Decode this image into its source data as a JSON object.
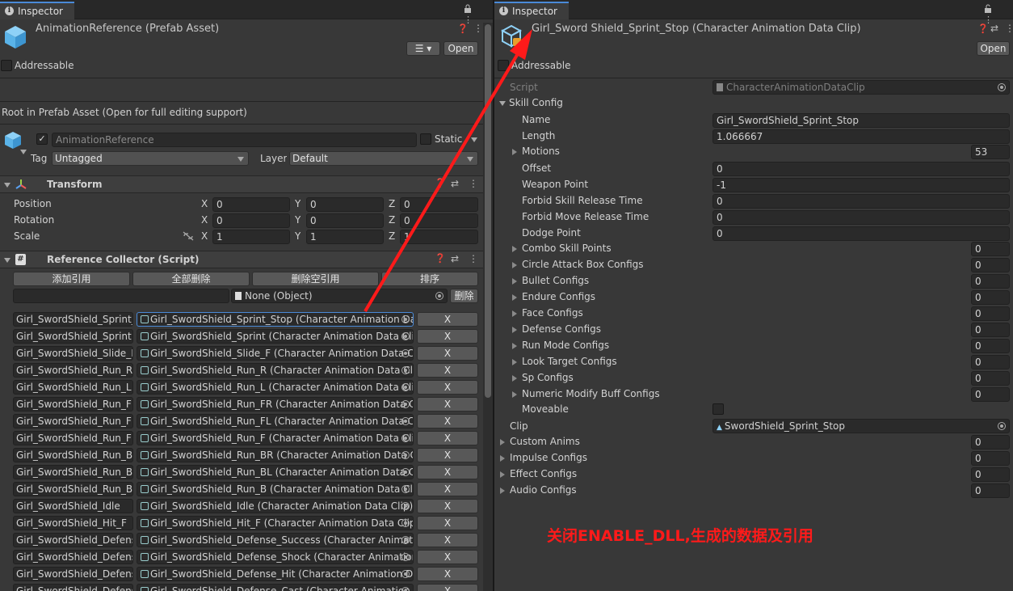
{
  "left": {
    "tab_label": "Inspector",
    "asset_title": "AnimationReference (Prefab Asset)",
    "open_button": "Open",
    "addressable_label": "Addressable",
    "root_info": "Root in Prefab Asset (Open for full editing support)",
    "gameobject_name": "AnimationReference",
    "static_label": "Static",
    "tag_label": "Tag",
    "tag_value": "Untagged",
    "layer_label": "Layer",
    "layer_value": "Default",
    "transform": {
      "title": "Transform",
      "rows": [
        {
          "label": "Position",
          "x": "0",
          "y": "0",
          "z": "0"
        },
        {
          "label": "Rotation",
          "x": "0",
          "y": "0",
          "z": "0"
        },
        {
          "label": "Scale",
          "x": "1",
          "y": "1",
          "z": "1"
        }
      ],
      "axis_x": "X",
      "axis_y": "Y",
      "axis_z": "Z"
    },
    "collector": {
      "title": "Reference Collector (Script)",
      "buttons": [
        "添加引用",
        "全部删除",
        "删除空引用",
        "排序"
      ],
      "none_object": "None (Object)",
      "delete_button": "删除",
      "x_label": "X",
      "items": [
        {
          "key": "Girl_SwordShield_Sprint_S",
          "obj": "Girl_SwordShield_Sprint_Stop (Character Animation Dat"
        },
        {
          "key": "Girl_SwordShield_Sprint",
          "obj": "Girl_SwordShield_Sprint (Character Animation Data Clip"
        },
        {
          "key": "Girl_SwordShield_Slide_F",
          "obj": "Girl_SwordShield_Slide_F (Character Animation Data Cl"
        },
        {
          "key": "Girl_SwordShield_Run_R",
          "obj": "Girl_SwordShield_Run_R (Character Animation Data Clip"
        },
        {
          "key": "Girl_SwordShield_Run_L",
          "obj": "Girl_SwordShield_Run_L (Character Animation Data Clip"
        },
        {
          "key": "Girl_SwordShield_Run_FR",
          "obj": "Girl_SwordShield_Run_FR (Character Animation Data Cl"
        },
        {
          "key": "Girl_SwordShield_Run_FL",
          "obj": "Girl_SwordShield_Run_FL (Character Animation Data Cl"
        },
        {
          "key": "Girl_SwordShield_Run_F",
          "obj": "Girl_SwordShield_Run_F (Character Animation Data Clip"
        },
        {
          "key": "Girl_SwordShield_Run_BR",
          "obj": "Girl_SwordShield_Run_BR (Character Animation Data C"
        },
        {
          "key": "Girl_SwordShield_Run_BL",
          "obj": "Girl_SwordShield_Run_BL (Character Animation Data Cl"
        },
        {
          "key": "Girl_SwordShield_Run_B",
          "obj": "Girl_SwordShield_Run_B (Character Animation Data Clip"
        },
        {
          "key": "Girl_SwordShield_Idle",
          "obj": "Girl_SwordShield_Idle (Character Animation Data Clip)"
        },
        {
          "key": "Girl_SwordShield_Hit_F",
          "obj": "Girl_SwordShield_Hit_F (Character Animation Data Clip)"
        },
        {
          "key": "Girl_SwordShield_Defense",
          "obj": "Girl_SwordShield_Defense_Success (Character Animati"
        },
        {
          "key": "Girl_SwordShield_Defense",
          "obj": "Girl_SwordShield_Defense_Shock (Character Animatior"
        },
        {
          "key": "Girl_SwordShield_Defense",
          "obj": "Girl_SwordShield_Defense_Hit (Character Animation Da"
        },
        {
          "key": "Girl_SwordShield_Defense",
          "obj": "Girl_SwordShield_Defense_Cast (Character Animation D"
        }
      ]
    }
  },
  "right": {
    "tab_label": "Inspector",
    "asset_title": "Girl_Sword Shield_Sprint_Stop (Character Animation Data Clip)",
    "open_button": "Open",
    "addressable_label": "Addressable",
    "script_label": "Script",
    "script_value": "CharacterAnimationDataClip",
    "skill_config_label": "Skill Config",
    "fields": [
      {
        "label": "Name",
        "value": "Girl_SwordShield_Sprint_Stop"
      },
      {
        "label": "Length",
        "value": "1.066667"
      }
    ],
    "motions": {
      "label": "Motions",
      "count": "53"
    },
    "fields2": [
      {
        "label": "Offset",
        "value": "0"
      },
      {
        "label": "Weapon Point",
        "value": "-1"
      },
      {
        "label": "Forbid Skill Release Time",
        "value": "0"
      },
      {
        "label": "Forbid Move Release Time",
        "value": "0"
      },
      {
        "label": "Dodge Point",
        "value": "0"
      }
    ],
    "foldouts": [
      {
        "label": "Combo Skill Points",
        "count": "0"
      },
      {
        "label": "Circle Attack Box Configs",
        "count": "0"
      },
      {
        "label": "Bullet Configs",
        "count": "0"
      },
      {
        "label": "Endure Configs",
        "count": "0"
      },
      {
        "label": "Face Configs",
        "count": "0"
      },
      {
        "label": "Defense Configs",
        "count": "0"
      },
      {
        "label": "Run Mode Configs",
        "count": "0"
      },
      {
        "label": "Look Target Configs",
        "count": "0"
      },
      {
        "label": "Sp Configs",
        "count": "0"
      },
      {
        "label": "Numeric Modify Buff Configs",
        "count": "0"
      }
    ],
    "moveable_label": "Moveable",
    "clip_label": "Clip",
    "clip_value": "SwordShield_Sprint_Stop",
    "top_foldouts": [
      {
        "label": "Custom Anims",
        "count": "0"
      },
      {
        "label": "Impulse Configs",
        "count": "0"
      },
      {
        "label": "Effect Configs",
        "count": "0"
      },
      {
        "label": "Audio Configs",
        "count": "0"
      }
    ]
  },
  "annotation": "关闭ENABLE_DLL,生成的数据及引用",
  "colors": {
    "annotation": "#ff1a1a",
    "arrow": "#ff1a1a",
    "tab_accent": "#4a8ad8"
  }
}
